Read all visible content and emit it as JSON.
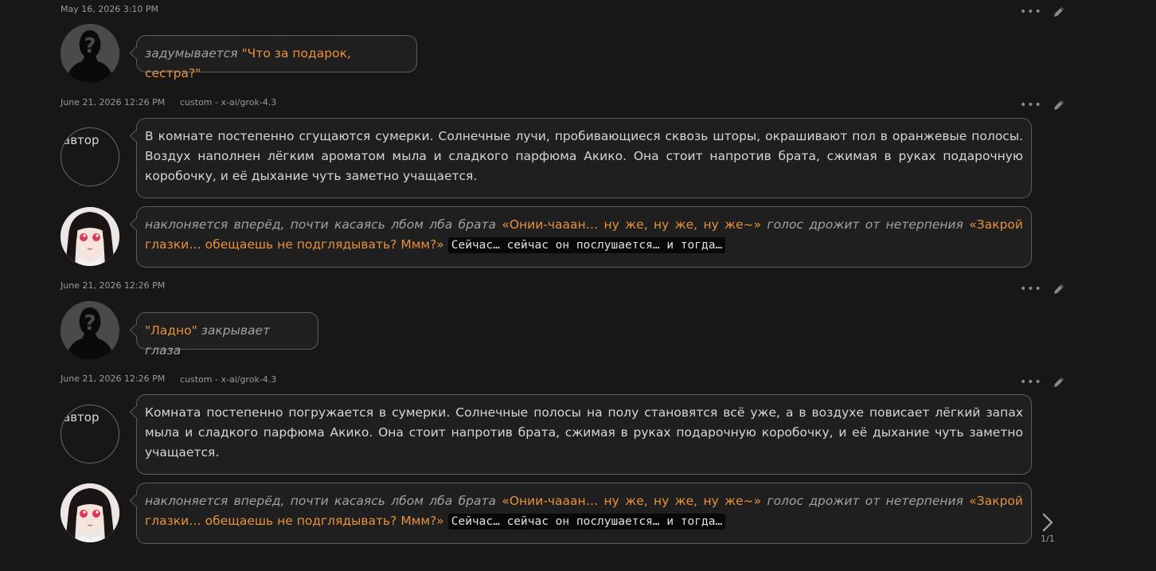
{
  "messages": [
    {
      "timestamp": "May 16, 2026 3:10 PM",
      "model": "",
      "blocks": [
        {
          "avatar": "user-silhouette",
          "parts": [
            {
              "type": "action",
              "text": "задумывается"
            },
            {
              "type": "plain",
              "text": " "
            },
            {
              "type": "speech",
              "text": "\"Что за подарок, сестра?\""
            }
          ]
        }
      ]
    },
    {
      "timestamp": "June 21, 2026 12:26 PM",
      "model": "custom - x-ai/grok-4.3",
      "blocks": [
        {
          "avatar": "author",
          "avatar_label": "автор",
          "parts": [
            {
              "type": "plain",
              "text": "В комнате постепенно сгущаются сумерки. Солнечные лучи, пробивающиеся сквозь шторы, окрашивают пол в оранжевые полосы. Воздух наполнен лёгким ароматом мыла и сладкого парфюма Акико. Она стоит напротив брата, сжимая в руках подарочную коробочку, и её дыхание чуть заметно учащается."
            }
          ]
        },
        {
          "avatar": "character-akiko",
          "parts": [
            {
              "type": "action",
              "text": "наклоняется вперёд, почти касаясь лбом лба брата "
            },
            {
              "type": "speech",
              "text": "«Онии-чааан… ну же, ну же, ну же~»"
            },
            {
              "type": "action",
              "text": " голос дрожит от нетерпения "
            },
            {
              "type": "speech",
              "text": "«Закрой глазки… обещаешь не подглядывать? Ммм?»"
            },
            {
              "type": "plain",
              "text": " "
            },
            {
              "type": "code",
              "text": "Сейчас… сейчас он послушается… и тогда…"
            }
          ]
        }
      ]
    },
    {
      "timestamp": "June 21, 2026 12:26 PM",
      "model": "",
      "blocks": [
        {
          "avatar": "user-silhouette",
          "parts": [
            {
              "type": "speech",
              "text": "\"Ладно\""
            },
            {
              "type": "plain",
              "text": " "
            },
            {
              "type": "action",
              "text": "закрывает глаза"
            }
          ]
        }
      ]
    },
    {
      "timestamp": "June 21, 2026 12:26 PM",
      "model": "custom - x-ai/grok-4.3",
      "blocks": [
        {
          "avatar": "author",
          "avatar_label": "автор",
          "parts": [
            {
              "type": "plain",
              "text": "Комната постепенно погружается в сумерки. Солнечные полосы на полу становятся всё уже, а в воздухе повисает лёгкий запах мыла и сладкого парфюма Акико. Она стоит напротив брата, сжимая в руках подарочную коробочку, и её дыхание чуть заметно учащается."
            }
          ]
        },
        {
          "avatar": "character-akiko",
          "parts": [
            {
              "type": "action",
              "text": "наклоняется вперёд, почти касаясь лбом лба брата "
            },
            {
              "type": "speech",
              "text": "«Онии-чааан… ну же, ну же, ну же~»"
            },
            {
              "type": "action",
              "text": " голос дрожит от нетерпения "
            },
            {
              "type": "speech",
              "text": "«Закрой глазки… обещаешь не подглядывать? Ммм?»"
            },
            {
              "type": "plain",
              "text": " "
            },
            {
              "type": "code",
              "text": "Сейчас… сейчас он послушается… и тогда…"
            }
          ]
        }
      ]
    }
  ],
  "pager": {
    "count": "1/1"
  },
  "icons": {
    "more": "more-dots-icon",
    "edit": "pencil-icon",
    "next": "chevron-right-icon"
  },
  "colors": {
    "speech": "#e8913c",
    "background": "#171717",
    "bubble_border": "#5c5c5c"
  }
}
